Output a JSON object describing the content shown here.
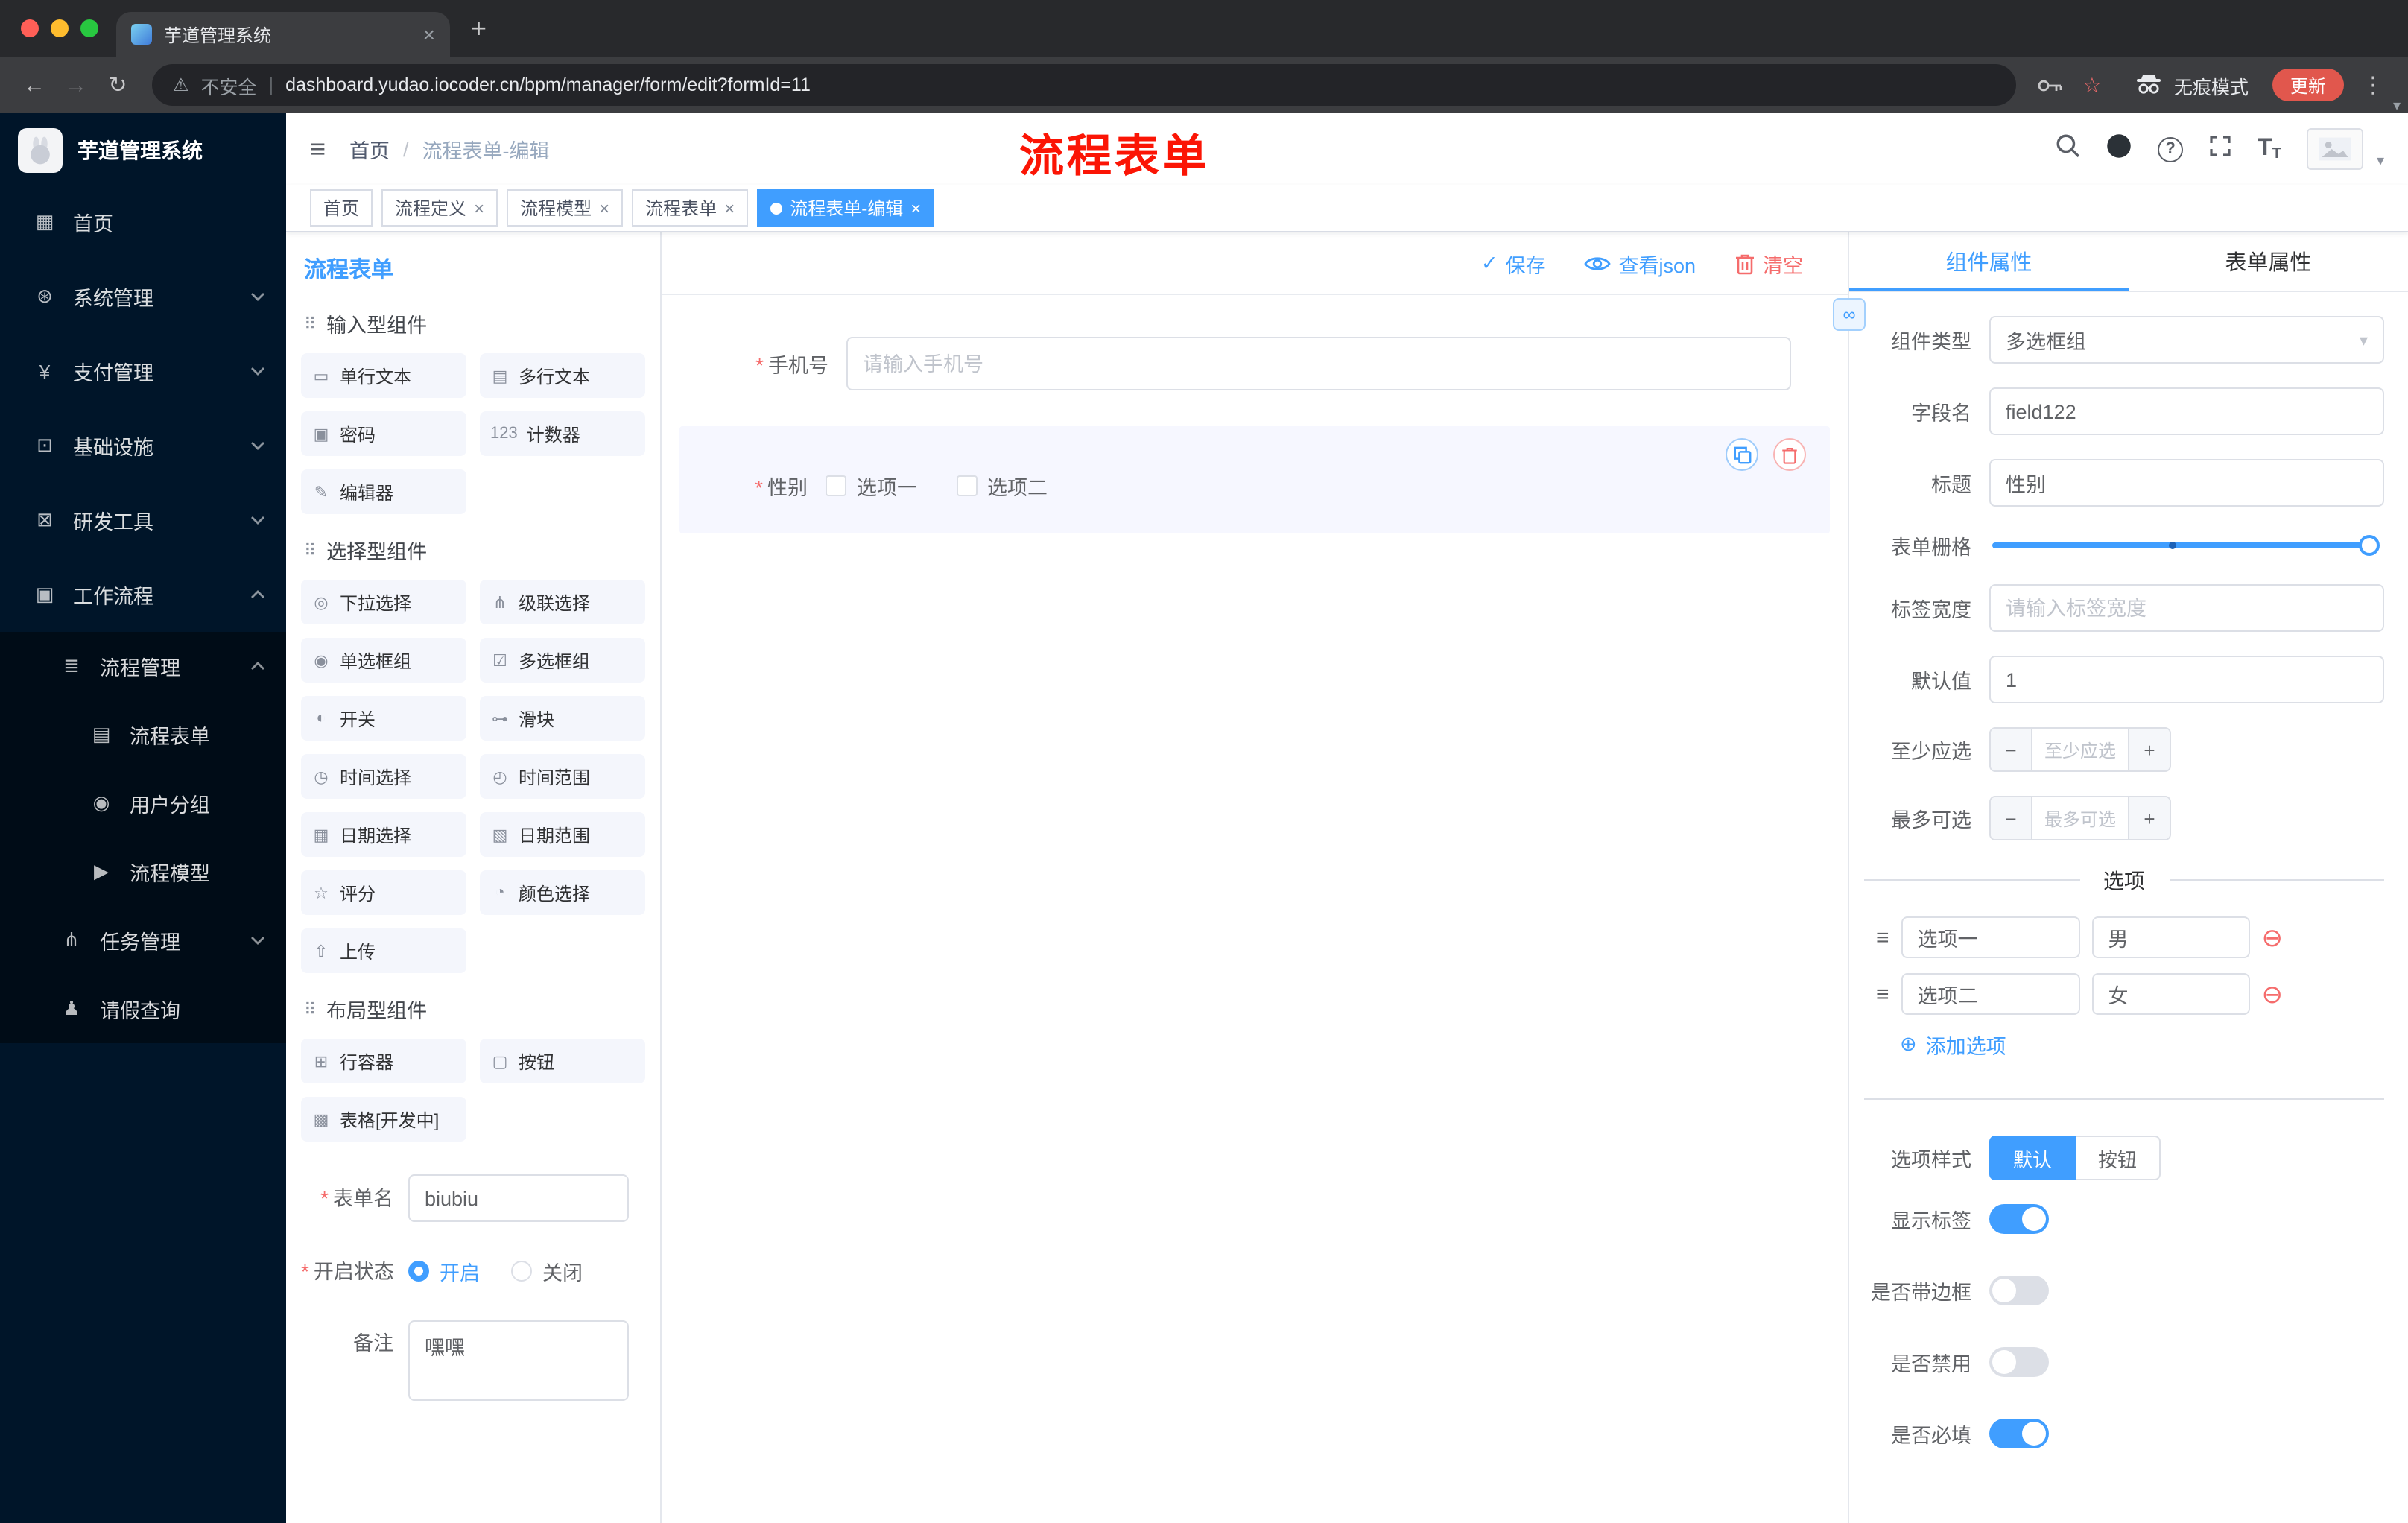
{
  "icons": {
    "back": "←",
    "forward": "→",
    "reload": "↻",
    "warning": "⚠",
    "divider": "|",
    "star": "☆",
    "menu_dots": "⋮",
    "new_tab": "+",
    "tab_close": "×",
    "hamburger": "≡",
    "breadcrumb_sep": "/",
    "question": "?",
    "text_size_big": "T",
    "text_size_small": "T",
    "caret_down": "▾",
    "check": "✓",
    "section_drag": "⠿",
    "required": "*",
    "add_circle": "⊕",
    "remove_circle": "⊖",
    "option_handle": "≡",
    "stepper_minus": "−",
    "stepper_plus": "+",
    "select_caret": "▾",
    "link": "∞"
  },
  "browser": {
    "tab_title": "芋道管理系统",
    "security_label": "不安全",
    "url": "dashboard.yudao.iocoder.cn/bpm/manager/form/edit?formId=11",
    "incognito_label": "无痕模式",
    "update_label": "更新"
  },
  "sidebar": {
    "logo_title": "芋道管理系统",
    "items": [
      {
        "label": "首页",
        "icon": "▦"
      },
      {
        "label": "系统管理",
        "icon": "⊛"
      },
      {
        "label": "支付管理",
        "icon": "¥"
      },
      {
        "label": "基础设施",
        "icon": "⊡"
      },
      {
        "label": "研发工具",
        "icon": "⊠"
      },
      {
        "label": "工作流程",
        "icon": "▣"
      },
      {
        "label": "流程管理",
        "icon": "≣"
      },
      {
        "label": "流程表单",
        "icon": "▤"
      },
      {
        "label": "用户分组",
        "icon": "◉"
      },
      {
        "label": "流程模型",
        "icon": "▶"
      },
      {
        "label": "任务管理",
        "icon": "⋔"
      },
      {
        "label": "请假查询",
        "icon": "♟"
      }
    ]
  },
  "header": {
    "breadcrumb_home": "首页",
    "breadcrumb_current": "流程表单-编辑",
    "annotation": "流程表单"
  },
  "tags": [
    {
      "label": "首页"
    },
    {
      "label": "流程定义"
    },
    {
      "label": "流程模型"
    },
    {
      "label": "流程表单"
    },
    {
      "label": "流程表单-编辑"
    }
  ],
  "designer": {
    "panel_title": "流程表单",
    "toolbar": {
      "save": "保存",
      "view_json": "查看json",
      "clear": "清空"
    },
    "sections": [
      {
        "title": "输入型组件",
        "items": [
          {
            "label": "单行文本",
            "icon": "▭"
          },
          {
            "label": "多行文本",
            "icon": "▤"
          },
          {
            "label": "密码",
            "icon": "▣"
          },
          {
            "label": "计数器",
            "icon": "123"
          },
          {
            "label": "编辑器",
            "icon": "✎"
          }
        ]
      },
      {
        "title": "选择型组件",
        "items": [
          {
            "label": "下拉选择",
            "icon": "◎"
          },
          {
            "label": "级联选择",
            "icon": "⋔"
          },
          {
            "label": "单选框组",
            "icon": "◉"
          },
          {
            "label": "多选框组",
            "icon": "☑"
          },
          {
            "label": "开关",
            "icon": "◐"
          },
          {
            "label": "滑块",
            "icon": "⊶"
          },
          {
            "label": "时间选择",
            "icon": "◷"
          },
          {
            "label": "时间范围",
            "icon": "◴"
          },
          {
            "label": "日期选择",
            "icon": "▦"
          },
          {
            "label": "日期范围",
            "icon": "▧"
          },
          {
            "label": "评分",
            "icon": "☆"
          },
          {
            "label": "颜色选择",
            "icon": "◔"
          },
          {
            "label": "上传",
            "icon": "⇧"
          }
        ]
      },
      {
        "title": "布局型组件",
        "items": [
          {
            "label": "行容器",
            "icon": "⊞"
          },
          {
            "label": "按钮",
            "icon": "▢"
          },
          {
            "label": "表格[开发中]",
            "icon": "▩"
          }
        ]
      }
    ],
    "form": {
      "name_label": "表单名",
      "name_value": "biubiu",
      "status_label": "开启状态",
      "status_on": "开启",
      "status_off": "关闭",
      "remark_label": "备注",
      "remark_value": "嘿嘿"
    }
  },
  "canvas": {
    "phone": {
      "label": "手机号",
      "placeholder": "请输入手机号"
    },
    "gender": {
      "label": "性别",
      "option1": "选项一",
      "option2": "选项二"
    }
  },
  "props": {
    "tab_component": "组件属性",
    "tab_form": "表单属性",
    "component_type": {
      "label": "组件类型",
      "value": "多选框组"
    },
    "field_name": {
      "label": "字段名",
      "value": "field122"
    },
    "title": {
      "label": "标题",
      "value": "性别"
    },
    "grid": {
      "label": "表单栅格"
    },
    "label_width": {
      "label": "标签宽度",
      "placeholder": "请输入标签宽度"
    },
    "default_value": {
      "label": "默认值",
      "value": "1"
    },
    "min_select": {
      "label": "至少应选",
      "placeholder": "至少应选"
    },
    "max_select": {
      "label": "最多可选",
      "placeholder": "最多可选"
    },
    "options_title": "选项",
    "options": [
      {
        "name": "选项一",
        "value": "男"
      },
      {
        "name": "选项二",
        "value": "女"
      }
    ],
    "add_option": "添加选项",
    "option_style": {
      "label": "选项样式",
      "default": "默认",
      "button": "按钮"
    },
    "switches": [
      {
        "label": "显示标签"
      },
      {
        "label": "是否带边框"
      },
      {
        "label": "是否禁用"
      },
      {
        "label": "是否必填"
      }
    ]
  }
}
